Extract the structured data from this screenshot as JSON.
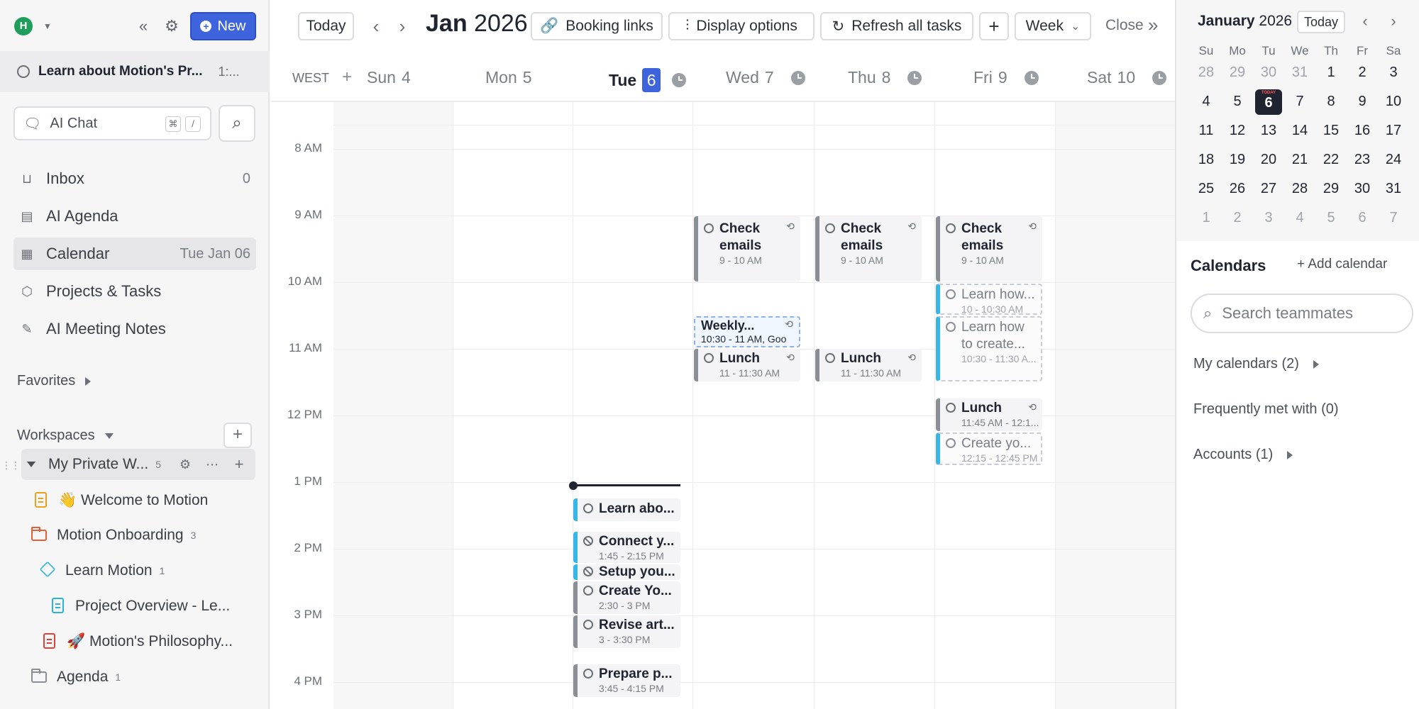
{
  "sidebar": {
    "avatar_initial": "H",
    "new_label": "New",
    "current_task": {
      "title": "Learn about Motion's Pr...",
      "time": "1:..."
    },
    "ai_chat": {
      "label": "AI Chat",
      "kbd1": "⌘",
      "kbd2": "/"
    },
    "nav": [
      {
        "label": "Inbox",
        "right": "0"
      },
      {
        "label": "AI Agenda",
        "right": ""
      },
      {
        "label": "Calendar",
        "right": "Tue Jan 06"
      },
      {
        "label": "Projects & Tasks",
        "right": ""
      },
      {
        "label": "AI Meeting Notes",
        "right": ""
      }
    ],
    "favorites_label": "Favorites",
    "workspaces_label": "Workspaces",
    "workspace": {
      "name": "My Private W...",
      "count": "5"
    },
    "tree": [
      {
        "label": "👋 Welcome to Motion",
        "count": ""
      },
      {
        "label": "Motion Onboarding",
        "count": "3"
      },
      {
        "label": "Learn Motion",
        "count": "1"
      },
      {
        "label": "Project Overview - Le...",
        "count": ""
      },
      {
        "label": "🚀 Motion's Philosophy...",
        "count": ""
      },
      {
        "label": "Agenda",
        "count": "1"
      }
    ]
  },
  "toolbar": {
    "today": "Today",
    "month": "Jan",
    "year": "2026",
    "booking_links": "Booking links",
    "display_options": "Display options",
    "refresh": "Refresh all tasks",
    "view": "Week",
    "close": "Close"
  },
  "calendar": {
    "timezone": "WEST",
    "days": [
      {
        "dow": "Sun",
        "num": "4"
      },
      {
        "dow": "Mon",
        "num": "5"
      },
      {
        "dow": "Tue",
        "num": "6"
      },
      {
        "dow": "Wed",
        "num": "7"
      },
      {
        "dow": "Thu",
        "num": "8"
      },
      {
        "dow": "Fri",
        "num": "9"
      },
      {
        "dow": "Sat",
        "num": "10"
      }
    ],
    "hours": [
      "8 AM",
      "9 AM",
      "10 AM",
      "11 AM",
      "12 PM",
      "1 PM",
      "2 PM",
      "3 PM",
      "4 PM"
    ],
    "events": {
      "wed_check": {
        "title": "Check emails",
        "time": "9 - 10 AM"
      },
      "thu_check": {
        "title": "Check emails",
        "time": "9 - 10 AM"
      },
      "fri_check": {
        "title": "Check emails",
        "time": "9 - 10 AM"
      },
      "wed_weekly": {
        "title": "Weekly...",
        "time": "10:30 - 11 AM, Goo"
      },
      "fri_learn1": {
        "title": "Learn how...",
        "time": "10 - 10:30 AM"
      },
      "fri_learn2": {
        "title": "Learn how to create...",
        "time": "10:30 - 11:30 A..."
      },
      "wed_lunch": {
        "title": "Lunch",
        "time": "11 - 11:30 AM"
      },
      "thu_lunch": {
        "title": "Lunch",
        "time": "11 - 11:30 AM"
      },
      "fri_lunch": {
        "title": "Lunch",
        "time": "11:45 AM - 12:1..."
      },
      "fri_create": {
        "title": "Create yo...",
        "time": "12:15 - 12:45 PM"
      },
      "tue_learn": {
        "title": "Learn abo...",
        "time": ""
      },
      "tue_connect": {
        "title": "Connect y...",
        "time": "1:45 - 2:15 PM"
      },
      "tue_setup": {
        "title": "Setup you...",
        "time": ""
      },
      "tue_create": {
        "title": "Create Yo...",
        "time": "2:30 - 3 PM"
      },
      "tue_revise": {
        "title": "Revise art...",
        "time": "3 - 3:30 PM"
      },
      "tue_prepare": {
        "title": "Prepare p...",
        "time": "3:45 - 4:15 PM"
      }
    }
  },
  "mini_calendar": {
    "month": "January",
    "year": "2026",
    "today_label": "Today",
    "dow": [
      "Su",
      "Mo",
      "Tu",
      "We",
      "Th",
      "Fr",
      "Sa"
    ],
    "weeks": [
      [
        "28",
        "29",
        "30",
        "31",
        "1",
        "2",
        "3"
      ],
      [
        "4",
        "5",
        "6",
        "7",
        "8",
        "9",
        "10"
      ],
      [
        "11",
        "12",
        "13",
        "14",
        "15",
        "16",
        "17"
      ],
      [
        "18",
        "19",
        "20",
        "21",
        "22",
        "23",
        "24"
      ],
      [
        "25",
        "26",
        "27",
        "28",
        "29",
        "30",
        "31"
      ],
      [
        "1",
        "2",
        "3",
        "4",
        "5",
        "6",
        "7"
      ]
    ],
    "selected": "6"
  },
  "calendars_panel": {
    "title": "Calendars",
    "add_label": "Add calendar",
    "search_placeholder": "Search teammates",
    "rows": [
      "My calendars (2)",
      "Frequently met with (0)",
      "Accounts (1)"
    ]
  },
  "colors": {
    "accent": "#3d63dd",
    "task_blue": "#38b6e8",
    "task_gray": "#8a8e95"
  }
}
